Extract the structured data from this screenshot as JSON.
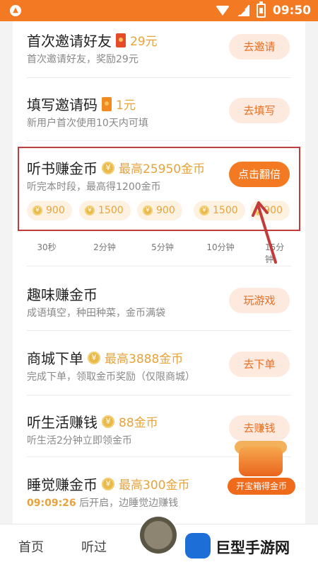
{
  "status": {
    "time": "09:50"
  },
  "rows": [
    {
      "title": "首次邀请好友",
      "reward": "29元",
      "subtitle": "首次邀请好友，奖励29元",
      "button": "去邀请"
    },
    {
      "title": "填写邀请码",
      "reward": "1元",
      "subtitle": "新用户首次使用10天内可填",
      "button": "去填写"
    },
    {
      "title": "听书赚金币",
      "reward": "最高25950金币",
      "subtitle": "听完本时段，最高得1200金币",
      "button": "点击翻倍"
    },
    {
      "title": "趣味赚金币",
      "reward": "",
      "subtitle": "成语填空，种田种菜，金币满袋",
      "button": "玩游戏"
    },
    {
      "title": "商城下单",
      "reward": "最高3888金币",
      "subtitle": "完成下单，领取金币奖励（仅限商城）",
      "button": "去下单"
    },
    {
      "title": "听生活赚钱",
      "reward": "88金币",
      "subtitle": "听生活2分钟立即领金币",
      "button": "去赚钱"
    },
    {
      "title": "睡觉赚金币",
      "reward": "最高300金币",
      "countdown": "09:09:26",
      "subtitle": "后开启，边睡觉边赚钱",
      "button": ""
    }
  ],
  "listen_chips": [
    "900",
    "1500",
    "900",
    "1500",
    "900"
  ],
  "listen_times": [
    "30秒",
    "2分钟",
    "5分钟",
    "10分钟",
    "15分钟"
  ],
  "treasure_label": "开宝箱得金币",
  "nav": {
    "home": "首页",
    "listened": "听过"
  },
  "watermark": "巨型手游网"
}
